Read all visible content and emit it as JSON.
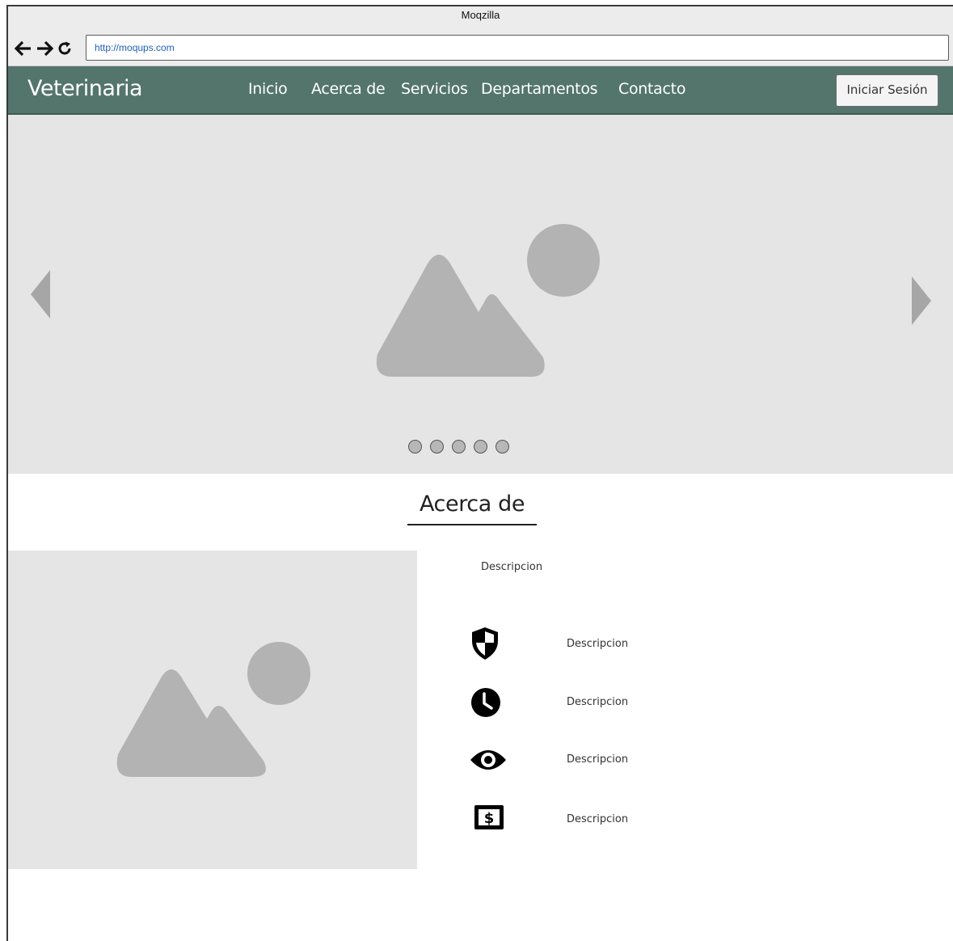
{
  "browser": {
    "title": "Moqzilla",
    "url": "http://moqups.com"
  },
  "header": {
    "brand": "Veterinaria",
    "nav": [
      {
        "label": "Inicio"
      },
      {
        "label": "Acerca de"
      },
      {
        "label": "Servicios"
      },
      {
        "label": "Departamentos"
      },
      {
        "label": "Contacto"
      }
    ],
    "login_label": "Iniciar Sesión"
  },
  "carousel": {
    "slide_count": 5,
    "prev_icon": "triangle-left-icon",
    "next_icon": "triangle-right-icon"
  },
  "about": {
    "title": "Acerca de",
    "description": "Descripcion",
    "features": [
      {
        "icon": "shield-icon",
        "text": "Descripcion"
      },
      {
        "icon": "clock-icon",
        "text": "Descripcion"
      },
      {
        "icon": "eye-icon",
        "text": "Descripcion"
      },
      {
        "icon": "dollar-sign-icon",
        "text": "Descripcion"
      }
    ]
  },
  "colors": {
    "header_bg": "#53756c",
    "placeholder_bg": "#e5e5e5",
    "placeholder_shape": "#b3b3b3",
    "url_text": "#1f5fbf"
  }
}
